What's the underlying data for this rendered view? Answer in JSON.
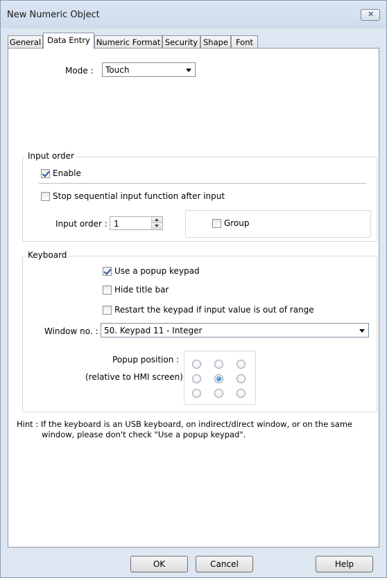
{
  "window": {
    "title": "New Numeric Object"
  },
  "tabs": [
    {
      "label": "General"
    },
    {
      "label": "Data Entry",
      "active": true
    },
    {
      "label": "Numeric Format"
    },
    {
      "label": "Security"
    },
    {
      "label": "Shape"
    },
    {
      "label": "Font"
    }
  ],
  "mode": {
    "label": "Mode :",
    "value": "Touch"
  },
  "input_order": {
    "group_title": "Input order",
    "enable": {
      "label": "Enable",
      "checked": true
    },
    "stop_sequential": {
      "label": "Stop sequential input function after input",
      "checked": false
    },
    "order": {
      "label": "Input order :",
      "value": "1"
    },
    "group_check": {
      "label": "Group",
      "checked": false
    }
  },
  "keyboard": {
    "group_title": "Keyboard",
    "use_popup": {
      "label": "Use a popup keypad",
      "checked": true
    },
    "hide_title": {
      "label": "Hide title bar",
      "checked": false
    },
    "restart": {
      "label": "Restart the keypad if input value is out of range",
      "checked": false
    },
    "window_no": {
      "label": "Window no. :",
      "value": "50. Keypad 11 - Integer"
    },
    "popup_position": {
      "label": "Popup position :",
      "sublabel": "(relative to HMI screen)",
      "selected": "center"
    }
  },
  "hint": {
    "line1": "Hint : If the keyboard is an USB keyboard, on indirect/direct window, or on the same",
    "line2": "window, please don't check \"Use a popup keypad\"."
  },
  "buttons": {
    "ok": "OK",
    "cancel": "Cancel",
    "help": "Help"
  },
  "colors": {
    "window_bg": "#dde6f1",
    "panel_bg": "#ffffff",
    "radio_selected": "#1a5fa8"
  }
}
